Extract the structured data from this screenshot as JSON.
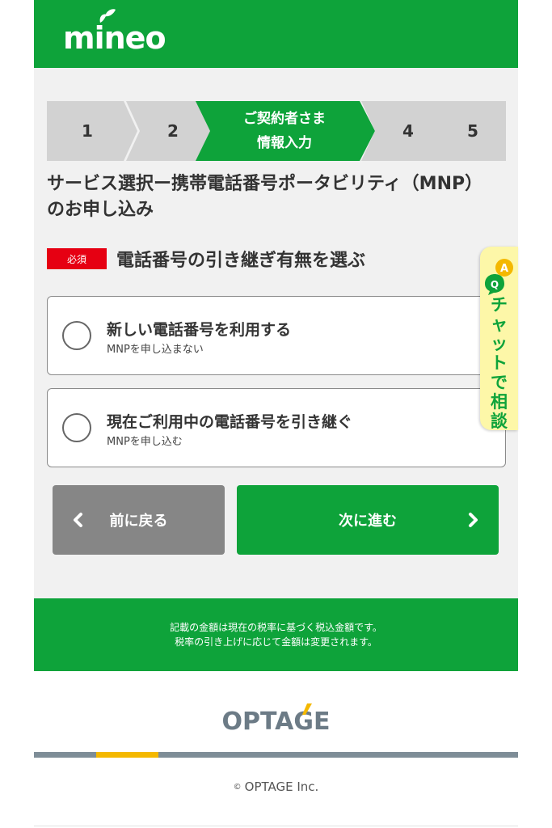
{
  "brand": {
    "logo": "mineo",
    "primary_color": "#0ea33a"
  },
  "steps": [
    {
      "label": "1",
      "active": false
    },
    {
      "label": "2",
      "active": false
    },
    {
      "label_line1": "ご契約者さま",
      "label_line2": "情報入力",
      "active": true
    },
    {
      "label": "4",
      "active": false
    },
    {
      "label": "5",
      "active": false
    }
  ],
  "service_title": "サービス選択ー携帯電話番号ポータビリティ（MNP）のお申し込み",
  "question": {
    "required_badge": "必須",
    "title": "電話番号の引き継ぎ有無を選ぶ"
  },
  "options": [
    {
      "title": "新しい電話番号を利用する",
      "sub": "MNPを申し込まない",
      "selected": false
    },
    {
      "title": "現在ご利用中の電話番号を引き継ぐ",
      "sub": "MNPを申し込む",
      "selected": false
    }
  ],
  "buttons": {
    "back": "前に戻る",
    "next": "次に進む"
  },
  "chat": {
    "badge_a": "A",
    "badge_q": "Q",
    "label": [
      "チ",
      "ャ",
      "ッ",
      "ト",
      "で",
      "相",
      "談"
    ]
  },
  "notice": {
    "line1": "記載の金額は現在の税率に基づく税込金額です。",
    "line2": "税率の引き上げに応じて金額は変更されます。"
  },
  "footer": {
    "company_logo": "OPTAGE",
    "copyright_symbol": "©",
    "copyright": "OPTAGE Inc."
  }
}
